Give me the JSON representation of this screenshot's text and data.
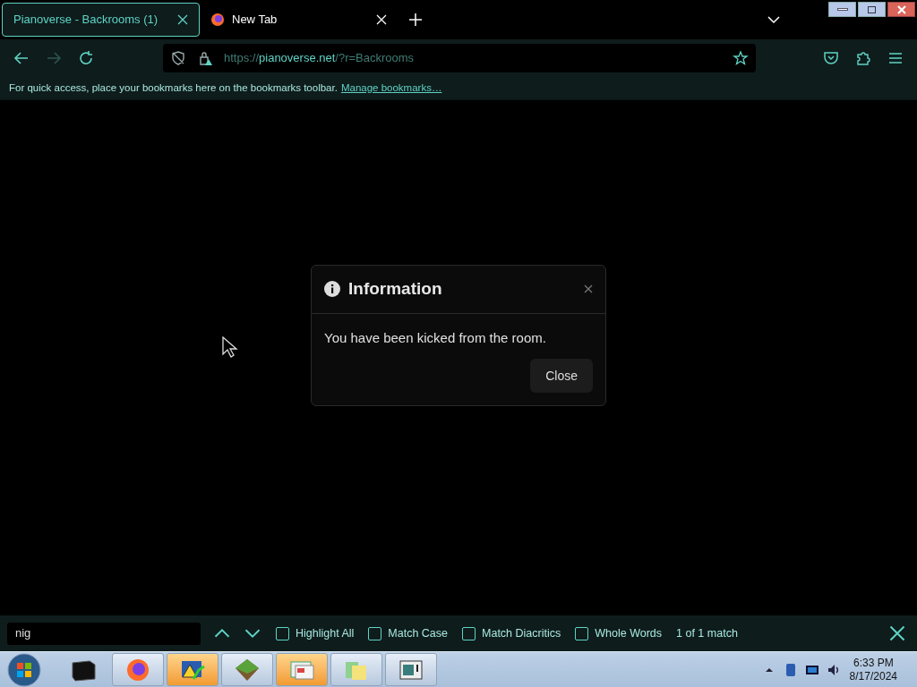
{
  "tabs": [
    {
      "title": "Pianoverse - Backrooms (1)",
      "selected": true,
      "icon": false
    },
    {
      "title": "New Tab",
      "selected": false,
      "icon": true
    }
  ],
  "address": {
    "scheme": "https://",
    "host": "pianoverse.net",
    "path": "/?r=Backrooms"
  },
  "bookmarks_bar": {
    "message": "For quick access, place your bookmarks here on the bookmarks toolbar.",
    "link": "Manage bookmarks…"
  },
  "dialog": {
    "title": "Information",
    "message": "You have been kicked from the room.",
    "button": "Close"
  },
  "find_bar": {
    "value": "nig",
    "options": [
      {
        "label": "Highlight All",
        "checked": false
      },
      {
        "label": "Match Case",
        "checked": false
      },
      {
        "label": "Match Diacritics",
        "checked": false
      },
      {
        "label": "Whole Words",
        "checked": false
      }
    ],
    "result": "1 of 1 match"
  },
  "taskbar": {
    "apps": [
      {
        "kind": "terminal",
        "running": false,
        "flashing": false
      },
      {
        "kind": "firefox",
        "running": true,
        "flashing": false
      },
      {
        "kind": "warning",
        "running": true,
        "flashing": true
      },
      {
        "kind": "cube",
        "running": true,
        "flashing": false
      },
      {
        "kind": "window",
        "running": true,
        "flashing": true
      },
      {
        "kind": "folder",
        "running": true,
        "flashing": false
      },
      {
        "kind": "document",
        "running": true,
        "flashing": false
      }
    ],
    "time": "6:33 PM",
    "date": "8/17/2024"
  }
}
